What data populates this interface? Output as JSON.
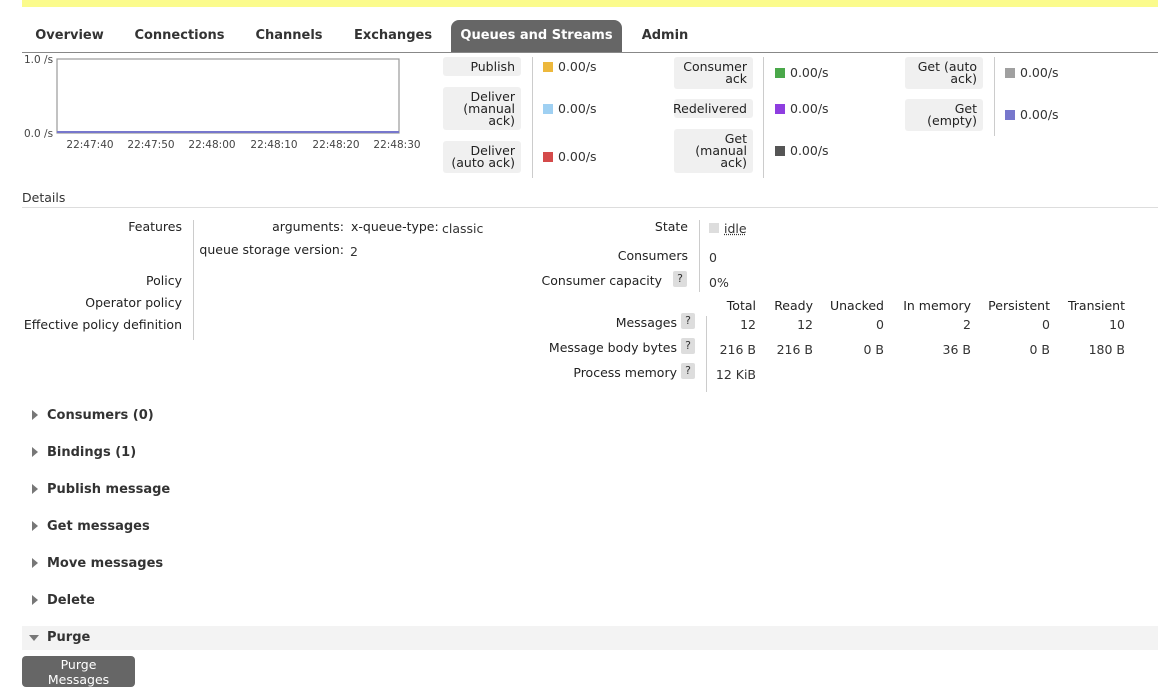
{
  "tabs": [
    "Overview",
    "Connections",
    "Channels",
    "Exchanges",
    "Queues and Streams",
    "Admin"
  ],
  "active_tab": "Queues and Streams",
  "chart_data": {
    "type": "line",
    "y_ticks": [
      "1.0 /s",
      "0.0 /s"
    ],
    "ylim": [
      0,
      1
    ],
    "x_ticks": [
      "22:47:40",
      "22:47:50",
      "22:48:00",
      "22:48:10",
      "22:48:20",
      "22:48:30"
    ],
    "series": [
      {
        "values": [
          0,
          0,
          0,
          0,
          0,
          0
        ]
      }
    ]
  },
  "rates": [
    {
      "label": "Publish",
      "value": "0.00/s",
      "color": "#edb83c"
    },
    {
      "label": "Deliver\n(manual\nack)",
      "value": "0.00/s",
      "color": "#9fd0f2"
    },
    {
      "label": "Deliver\n(auto ack)",
      "value": "0.00/s",
      "color": "#d44a4a"
    },
    {
      "label": "Consumer\nack",
      "value": "0.00/s",
      "color": "#4aa84a"
    },
    {
      "label": "Redelivered",
      "value": "0.00/s",
      "color": "#8e3ee0"
    },
    {
      "label": "Get\n(manual\nack)",
      "value": "0.00/s",
      "color": "#555555"
    },
    {
      "label": "Get (auto\nack)",
      "value": "0.00/s",
      "color": "#a0a0a0"
    },
    {
      "label": "Get\n(empty)",
      "value": "0.00/s",
      "color": "#7777cc"
    }
  ],
  "details": {
    "title": "Details",
    "features_label": "Features",
    "arguments_label": "arguments:",
    "x_queue_type_label": "x-queue-type:",
    "x_queue_type_value": "classic",
    "storage_label": "queue storage version:",
    "storage_value": "2",
    "policy_label": "Policy",
    "operator_policy_label": "Operator policy",
    "effective_policy_label": "Effective policy definition",
    "state_label": "State",
    "state_value": "idle",
    "consumers_label": "Consumers",
    "consumers_value": "0",
    "capacity_label": "Consumer capacity",
    "capacity_value": "0%",
    "help": "?",
    "columns": [
      "Total",
      "Ready",
      "Unacked",
      "In memory",
      "Persistent",
      "Transient"
    ],
    "messages_label": "Messages",
    "messages": [
      "12",
      "12",
      "0",
      "2",
      "0",
      "10"
    ],
    "body_bytes_label": "Message body bytes",
    "body_bytes": [
      "216 B",
      "216 B",
      "0 B",
      "36 B",
      "0 B",
      "180 B"
    ],
    "process_memory_label": "Process memory",
    "process_memory_value": "12 KiB"
  },
  "sections": [
    "Consumers (0)",
    "Bindings (1)",
    "Publish message",
    "Get messages",
    "Move messages",
    "Delete",
    "Purge"
  ],
  "purge_button": "Purge Messages"
}
